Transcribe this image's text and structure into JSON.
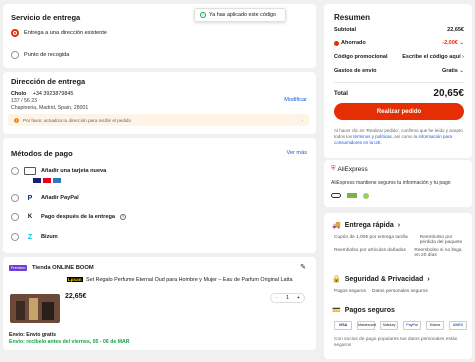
{
  "toast": {
    "text": "Ya has aplicado este código"
  },
  "delivery_service": {
    "title": "Servicio de entrega",
    "options": [
      {
        "label": "Entrega a una dirección existente",
        "selected": true
      },
      {
        "label": "Punto de recogida",
        "selected": false
      }
    ]
  },
  "address": {
    "title": "Dirección de entrega",
    "name": "Cholo",
    "phone": "+34 3923879845",
    "line1": "137 / 56 23",
    "line2": "Chapineria, Madrid, Spain, 28001",
    "edit_label": "Modificar",
    "notice": "Por favor, actualiza tu dirección para recibir el pedido"
  },
  "payment": {
    "title": "Métodos de pago",
    "more_label": "Ver más",
    "methods": [
      {
        "label": "Añadir una tarjeta nueva",
        "icon": "credit-card-icon"
      },
      {
        "label": "Añadir PayPal",
        "icon": "paypal-icon"
      },
      {
        "label": "Pago después de la entrega",
        "icon": "klarna-icon"
      },
      {
        "label": "Bizum",
        "icon": "bizum-icon"
      }
    ]
  },
  "store": {
    "badge": "Premium",
    "name": "Tienda ONLINE BOOM",
    "product_tag": "Lpcan",
    "product_title": "Set Regalo Perfume Eternal Oud para Hombre y Mujer – Eau de Parfum Original Latta",
    "price": "22,65€",
    "quantity": "1",
    "shipping_label": "Envío: Envío gratis",
    "delivery_estimate": "Envío: recibelo antes del viernes, 05 - 06 de MAR"
  },
  "summary": {
    "title": "Resumen",
    "rows": [
      {
        "label": "Subtotal",
        "value": "22,65€"
      },
      {
        "label": "Ahorrado",
        "value": "-2,00€"
      },
      {
        "label": "Código promocional",
        "value": "Escribe el código aquí"
      },
      {
        "label": "Gastos de envío",
        "value": "Gratis"
      }
    ],
    "total_label": "Total",
    "total_value": "20,65€",
    "button_label": "Realizar pedido",
    "terms_prefix": "Al hacer clic en 'Realizar pedido', confirmo que he leído y acepto todos los ",
    "terms_link": "términos y políticas",
    "terms_mid": ", así como la ",
    "info_link": "información para consumidores en la UE",
    "terms_suffix": "."
  },
  "aliexpress": {
    "brand": "AliExpress",
    "protection_text": "AliExpress mantiene seguros tu información y tu pago"
  },
  "benefits": {
    "fast_title": "Entrega rápida",
    "fast_items": [
      "Cupón de 1,00€ por entrega tardía",
      "Reembolso por pérdida del paquete",
      "Reembolso por artículos dañados",
      "Reembolso si no llega en 20 días"
    ],
    "privacy_title": "Seguridad & Privacidad",
    "privacy_items": [
      "Pagos seguros",
      "Datos personales seguros"
    ],
    "payments_title": "Pagos seguros",
    "payment_logos": [
      "VISA",
      "Mastercard",
      "Safekey",
      "PayPal",
      "Klarna",
      "AMEX"
    ],
    "footer": "Con socios de pago populares tus datos personales están seguros"
  },
  "colors": {
    "accent": "#e62e04",
    "link": "#1a5ad7",
    "success": "#17a34a"
  }
}
